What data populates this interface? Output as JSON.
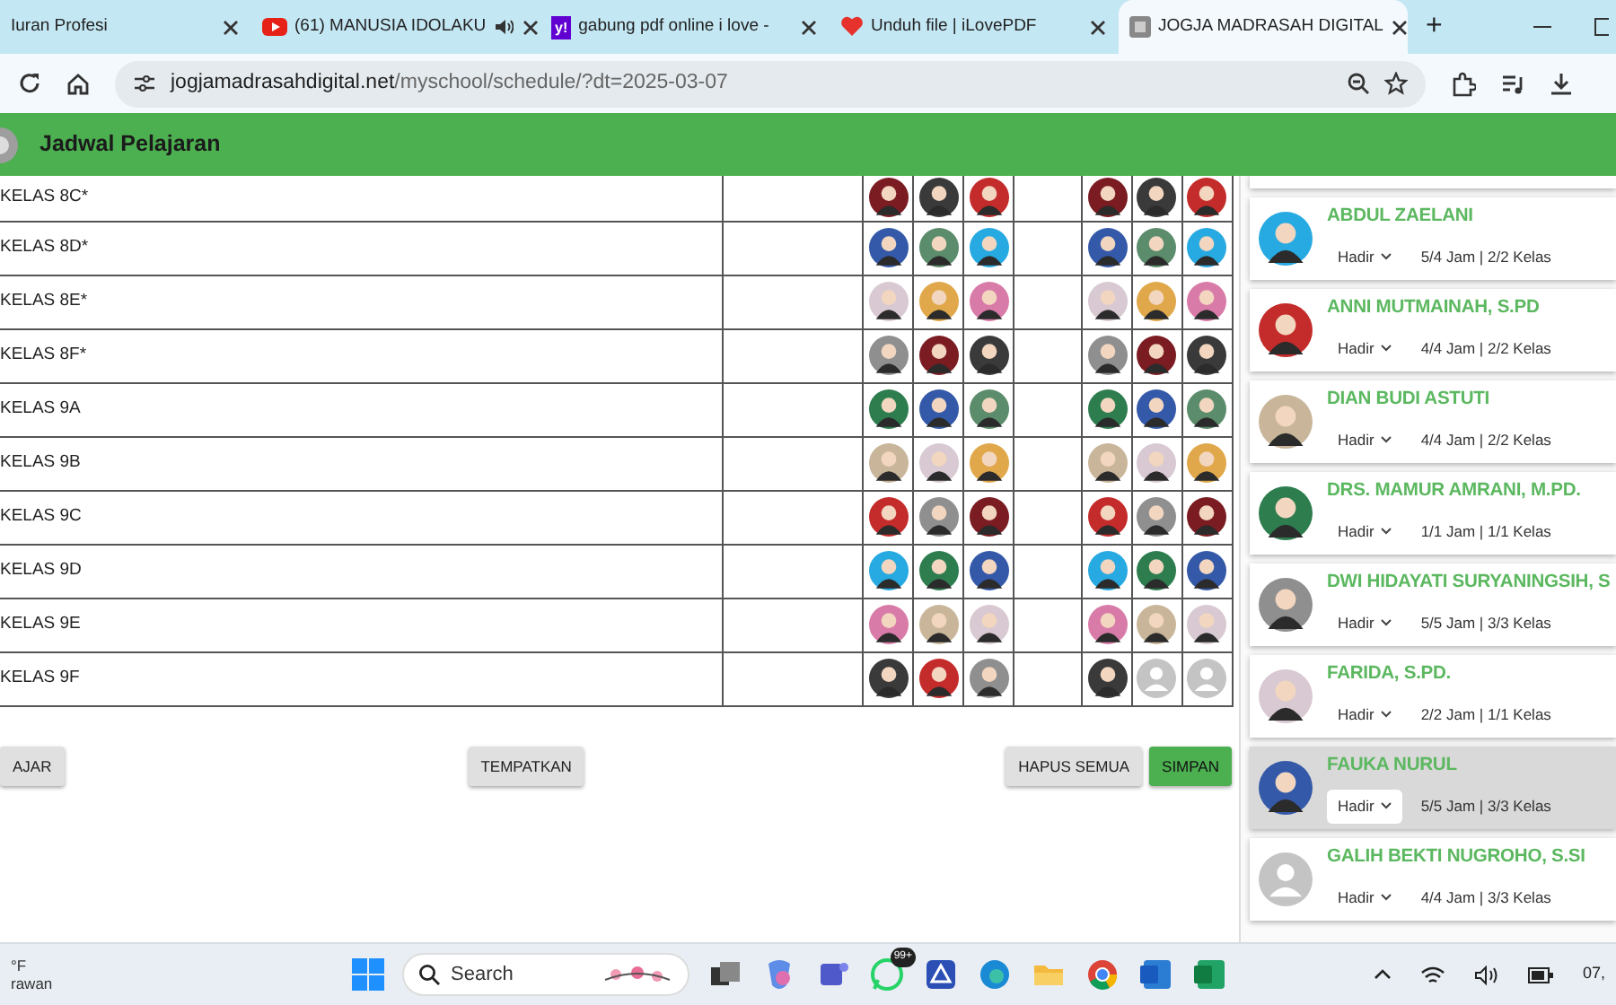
{
  "browser": {
    "tabs": [
      {
        "title": "Iuran Profesi",
        "kind": "none",
        "selected": false
      },
      {
        "title": "(61) MANUSIA IDOLAKU",
        "kind": "video",
        "audio": true,
        "selected": false
      },
      {
        "title": "gabung pdf online i love -",
        "kind": "yahoo",
        "icon_text": "y!",
        "selected": false
      },
      {
        "title": "Unduh file | iLovePDF",
        "kind": "heart",
        "selected": false
      },
      {
        "title": "JOGJA MADRASAH DIGITAL",
        "kind": "page",
        "selected": true
      }
    ],
    "new_tab": "+",
    "url_host": "jogjamadrasahdigital.net",
    "url_path": "/myschool/schedule/?dt=2025-03-07"
  },
  "app": {
    "title": "Jadwal Pelajaran"
  },
  "schedule": {
    "rows": [
      {
        "label": "KELAS 8C*",
        "slots": [
          {
            "kind": "photo"
          },
          {
            "kind": "photo"
          },
          {
            "kind": "photo"
          },
          {
            "kind": "empty"
          },
          {
            "kind": "photo"
          },
          {
            "kind": "photo"
          },
          {
            "kind": "photo"
          }
        ]
      },
      {
        "label": "KELAS 8D*",
        "slots": [
          {
            "kind": "photo"
          },
          {
            "kind": "photo"
          },
          {
            "kind": "photo"
          },
          {
            "kind": "empty"
          },
          {
            "kind": "photo"
          },
          {
            "kind": "photo"
          },
          {
            "kind": "photo"
          }
        ]
      },
      {
        "label": "KELAS 8E*",
        "slots": [
          {
            "kind": "photo"
          },
          {
            "kind": "photo"
          },
          {
            "kind": "photo"
          },
          {
            "kind": "empty"
          },
          {
            "kind": "photo"
          },
          {
            "kind": "photo"
          },
          {
            "kind": "photo"
          }
        ]
      },
      {
        "label": "KELAS 8F*",
        "slots": [
          {
            "kind": "photo"
          },
          {
            "kind": "photo"
          },
          {
            "kind": "photo"
          },
          {
            "kind": "empty"
          },
          {
            "kind": "photo"
          },
          {
            "kind": "photo"
          },
          {
            "kind": "photo"
          }
        ]
      },
      {
        "label": "KELAS 9A",
        "slots": [
          {
            "kind": "photo"
          },
          {
            "kind": "photo"
          },
          {
            "kind": "photo"
          },
          {
            "kind": "empty"
          },
          {
            "kind": "photo"
          },
          {
            "kind": "photo"
          },
          {
            "kind": "photo"
          }
        ]
      },
      {
        "label": "KELAS 9B",
        "slots": [
          {
            "kind": "photo"
          },
          {
            "kind": "photo"
          },
          {
            "kind": "photo"
          },
          {
            "kind": "empty"
          },
          {
            "kind": "photo"
          },
          {
            "kind": "photo"
          },
          {
            "kind": "photo"
          }
        ]
      },
      {
        "label": "KELAS 9C",
        "slots": [
          {
            "kind": "photo"
          },
          {
            "kind": "photo"
          },
          {
            "kind": "photo"
          },
          {
            "kind": "empty"
          },
          {
            "kind": "photo"
          },
          {
            "kind": "photo"
          },
          {
            "kind": "photo"
          }
        ]
      },
      {
        "label": "KELAS 9D",
        "slots": [
          {
            "kind": "photo"
          },
          {
            "kind": "photo"
          },
          {
            "kind": "photo"
          },
          {
            "kind": "empty"
          },
          {
            "kind": "photo"
          },
          {
            "kind": "photo"
          },
          {
            "kind": "photo"
          }
        ]
      },
      {
        "label": "KELAS 9E",
        "slots": [
          {
            "kind": "photo"
          },
          {
            "kind": "photo"
          },
          {
            "kind": "photo"
          },
          {
            "kind": "empty"
          },
          {
            "kind": "photo"
          },
          {
            "kind": "photo"
          },
          {
            "kind": "photo"
          }
        ]
      },
      {
        "label": "KELAS 9F",
        "slots": [
          {
            "kind": "photo"
          },
          {
            "kind": "photo"
          },
          {
            "kind": "photo"
          },
          {
            "kind": "empty"
          },
          {
            "kind": "photo"
          },
          {
            "kind": "default"
          },
          {
            "kind": "default"
          }
        ]
      }
    ]
  },
  "buttons": [
    {
      "label": "AJAR",
      "kind": "plain"
    },
    {
      "label": "TEMPATKAN",
      "kind": "plain"
    },
    {
      "label": "HAPUS SEMUA",
      "kind": "plain"
    },
    {
      "label": "SIMPAN",
      "kind": "primary"
    }
  ],
  "teachers": [
    {
      "name": "ABDUL ZAELANI",
      "status": "Hadir",
      "summary": "5/4 Jam | 2/2 Kelas",
      "kind": "photo",
      "selected": false
    },
    {
      "name": "ANNI MUTMAINAH, S.PD",
      "status": "Hadir",
      "summary": "4/4 Jam | 2/2 Kelas",
      "kind": "photo",
      "selected": false
    },
    {
      "name": "DIAN BUDI ASTUTI",
      "status": "Hadir",
      "summary": "4/4 Jam | 2/2 Kelas",
      "kind": "photo",
      "selected": false
    },
    {
      "name": "DRS. MAMUR AMRANI, M.PD.",
      "status": "Hadir",
      "summary": "1/1 Jam | 1/1 Kelas",
      "kind": "photo",
      "selected": false
    },
    {
      "name": "DWI HIDAYATI SURYANINGSIH, S",
      "status": "Hadir",
      "summary": "5/5 Jam | 3/3 Kelas",
      "kind": "photo",
      "selected": false
    },
    {
      "name": "FARIDA, S.PD.",
      "status": "Hadir",
      "summary": "2/2 Jam | 1/1 Kelas",
      "kind": "photo",
      "selected": false
    },
    {
      "name": "FAUKA NURUL",
      "status": "Hadir",
      "summary": "5/5 Jam | 3/3 Kelas",
      "kind": "photo",
      "selected": true
    },
    {
      "name": "GALIH BEKTI NUGROHO, S.SI",
      "status": "Hadir",
      "summary": "4/4 Jam | 3/3 Kelas",
      "kind": "default",
      "selected": false
    }
  ],
  "taskbar": {
    "weather_temp": "°F",
    "weather_text": "rawan",
    "search_placeholder": "Search",
    "whatsapp_badge": "99+",
    "clock": "07,"
  }
}
